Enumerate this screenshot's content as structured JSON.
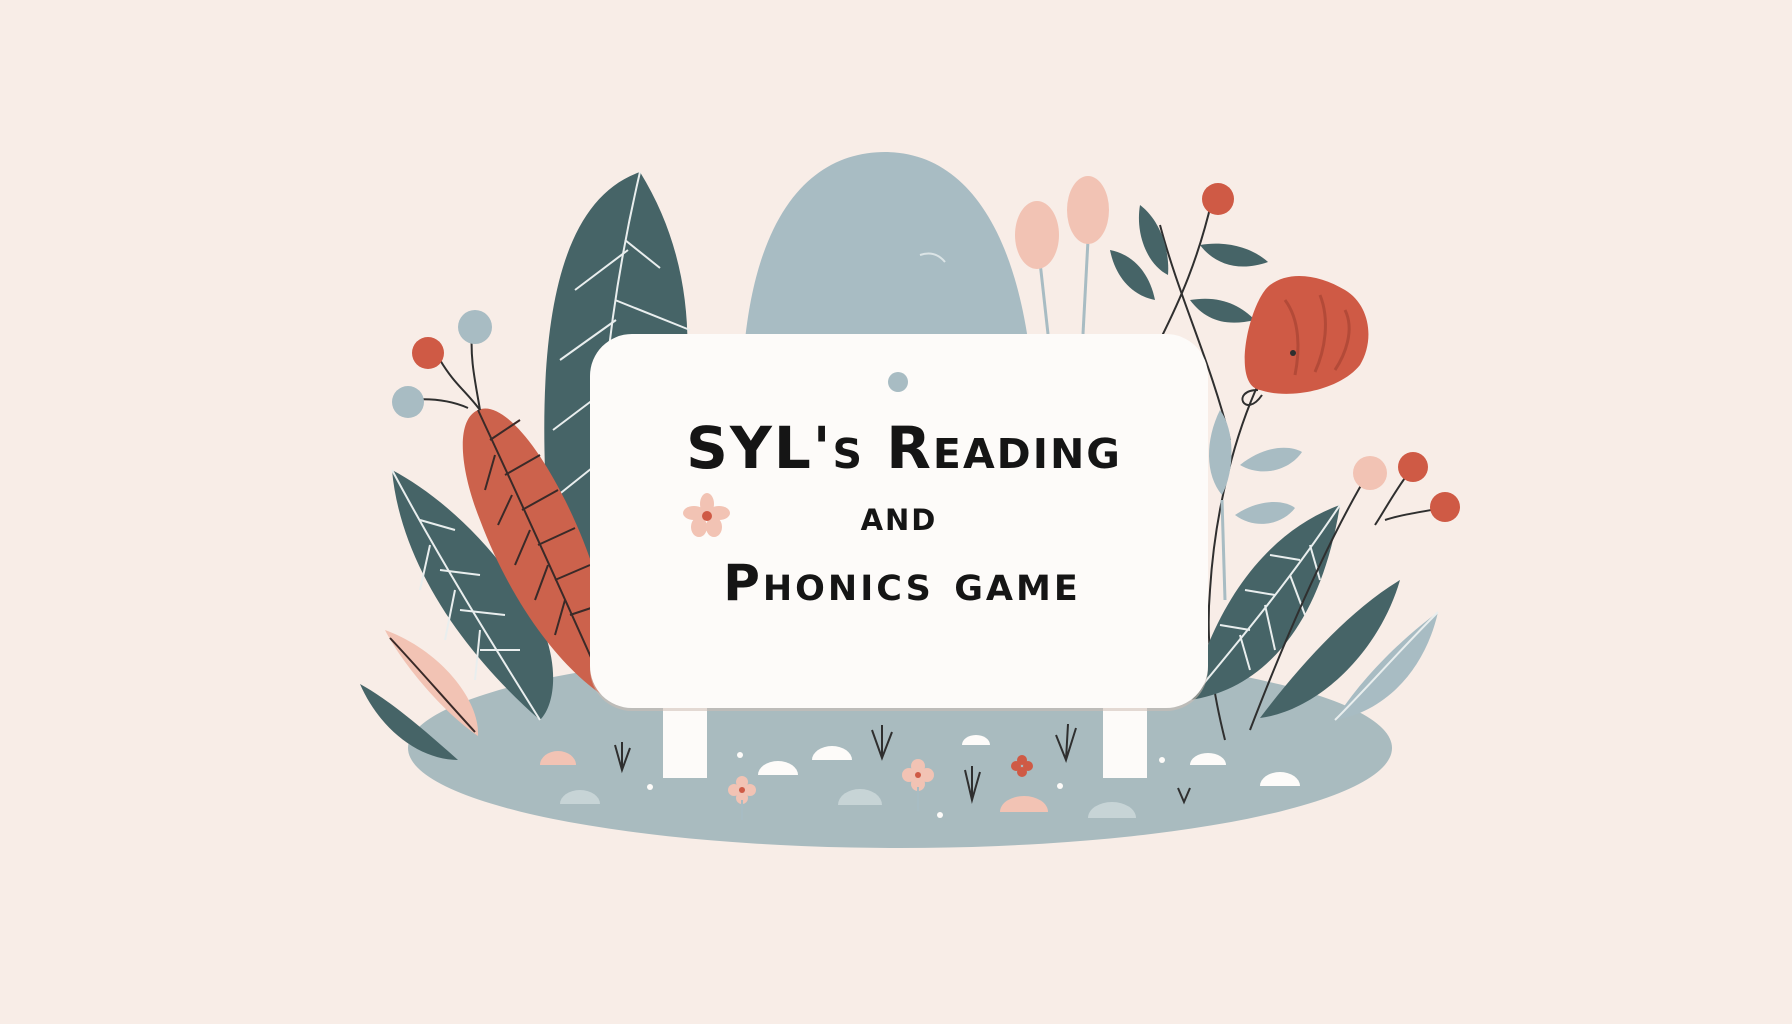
{
  "title": {
    "line1": "SYL's Reading",
    "line2": "and",
    "line3": "Phonics game"
  },
  "colors": {
    "background": "#f8ede7",
    "sign": "#fdfbf9",
    "ground": "#a9bbbf",
    "dark_leaf": "#466467",
    "rust_leaf": "#cc624c",
    "red_flower": "#cf5a45",
    "pink_bud": "#f2c3b4",
    "stone": "#a8bcc3",
    "text": "#151515"
  }
}
